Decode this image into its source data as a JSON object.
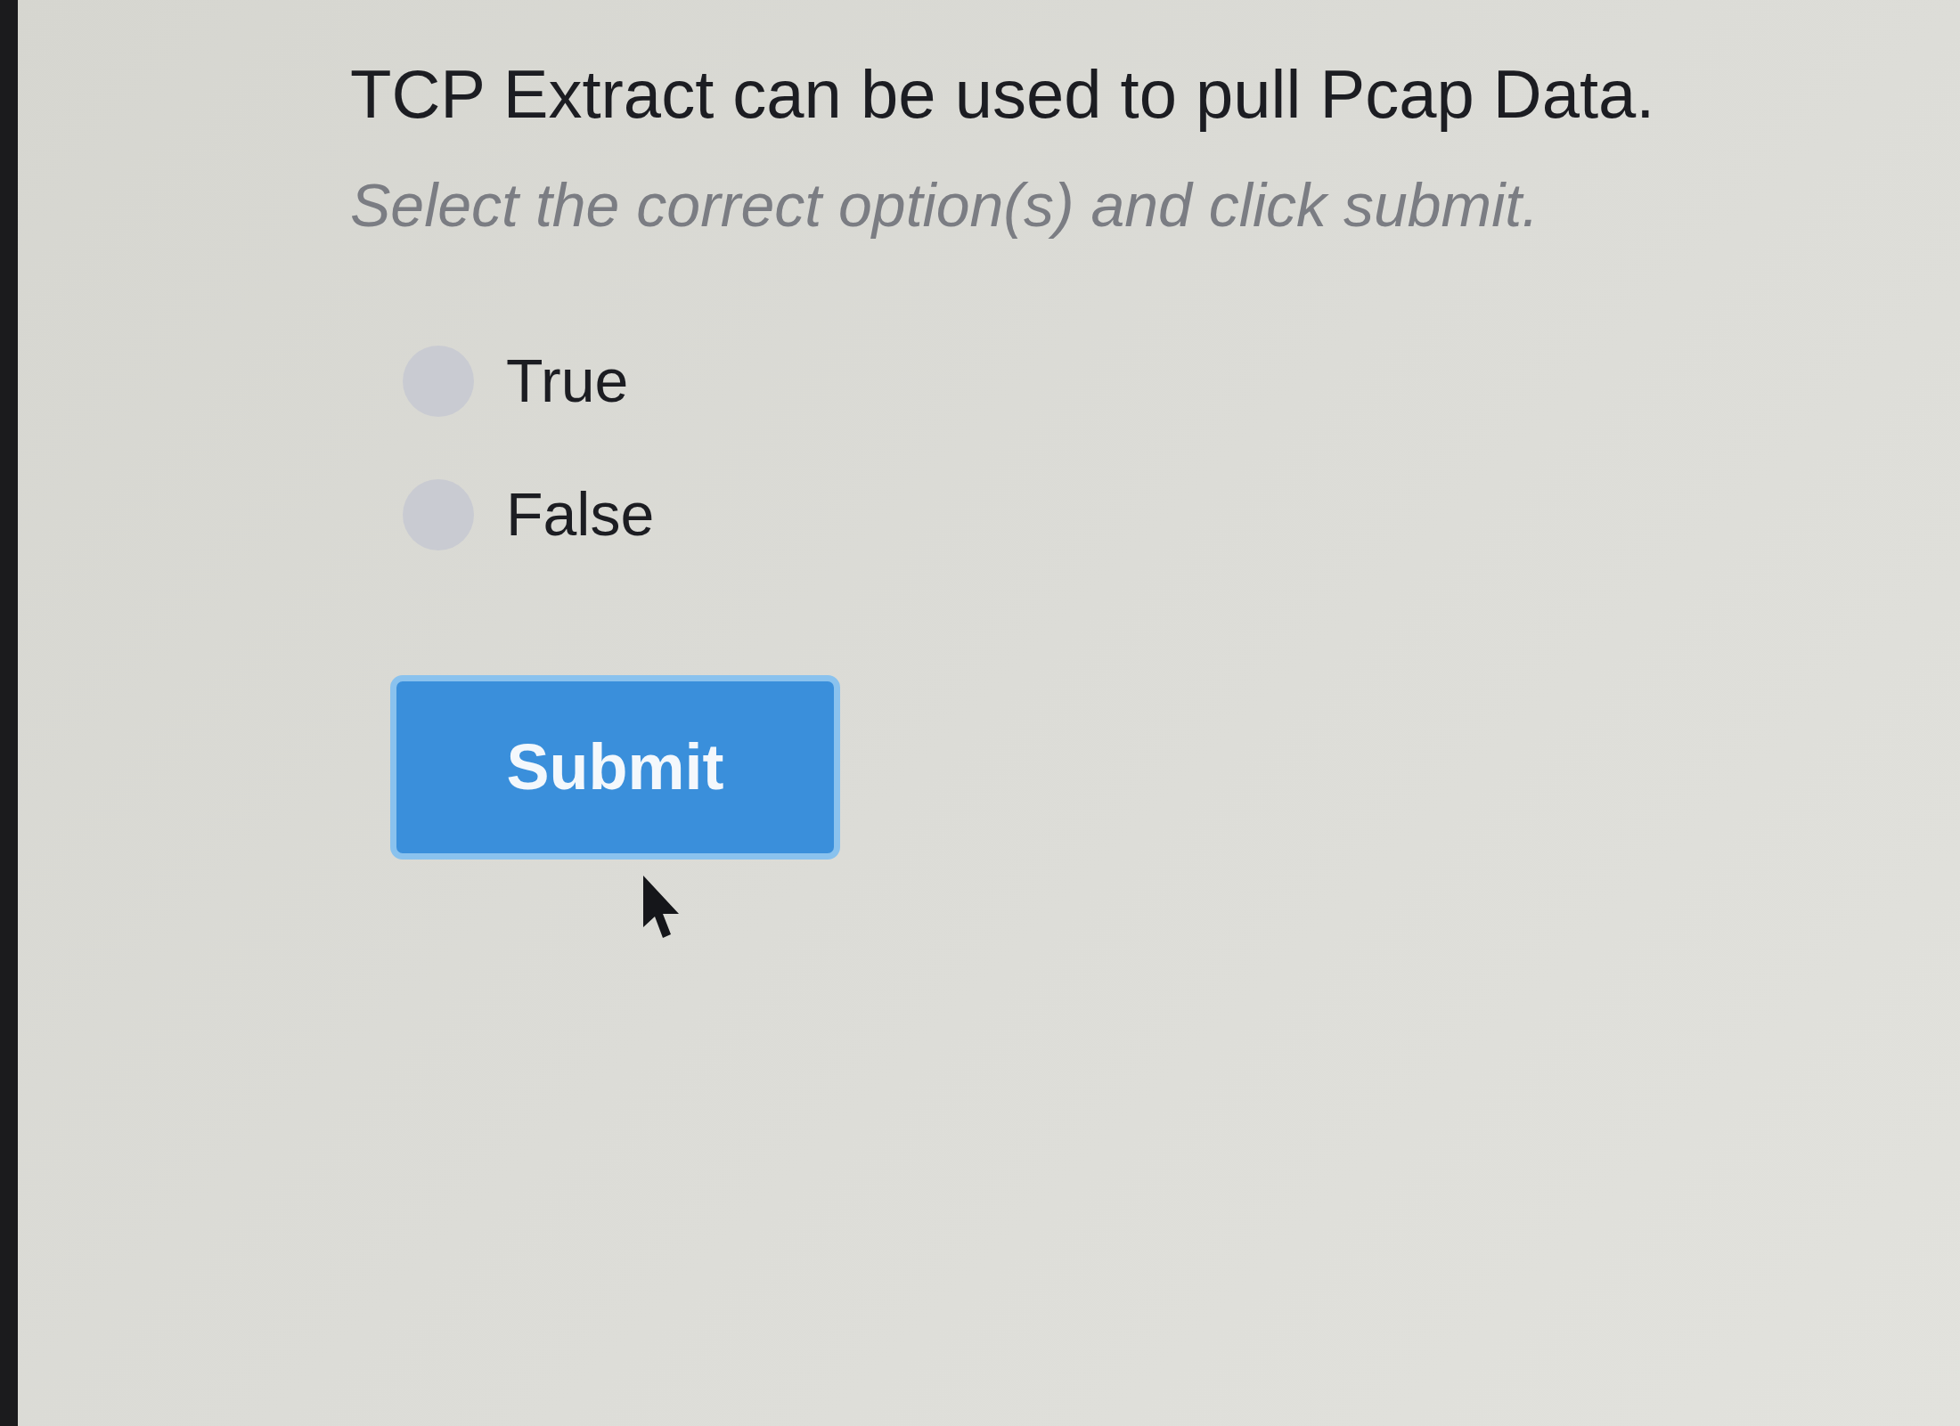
{
  "question": {
    "title": "TCP Extract can be used to pull Pcap Data.",
    "instruction": "Select the correct option(s) and click submit."
  },
  "options": [
    {
      "label": "True",
      "selected": false
    },
    {
      "label": "False",
      "selected": false
    }
  ],
  "submit_button": {
    "label": "Submit"
  }
}
